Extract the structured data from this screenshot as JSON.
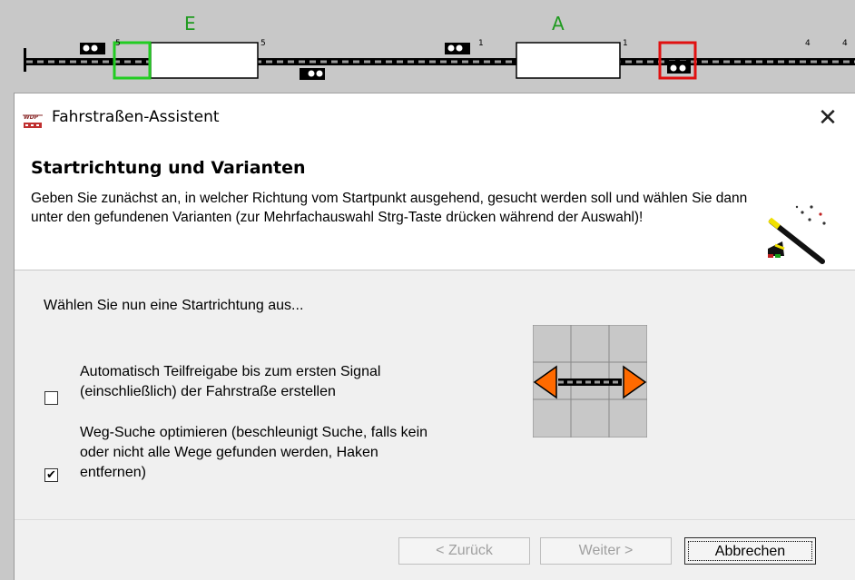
{
  "track": {
    "block_e_label": "E",
    "block_a_label": "A",
    "signal_numbers": [
      "5",
      "5",
      "1",
      "1",
      "4",
      "4"
    ],
    "start_marker_color": "#22cc22",
    "end_marker_color": "#e01010"
  },
  "dialog": {
    "title": "Fahrstraßen-Assistent",
    "close_glyph": "✕",
    "header_title": "Startrichtung und Varianten",
    "header_description": "Geben Sie zunächst an, in welcher Richtung vom Startpunkt ausgehend, gesucht werden soll und wählen Sie dann unter den gefundenen Varianten (zur Mehrfachauswahl Strg-Taste drücken während der Auswahl)!",
    "instruction": "Wählen Sie nun eine Startrichtung aus...",
    "options": [
      {
        "label": "Automatisch Teilfreigabe bis zum ersten Signal (einschließlich) der Fahrstraße erstellen",
        "checked": false,
        "mark": ""
      },
      {
        "label": "Weg-Suche optimieren (beschleunigt Suche, falls kein oder nicht alle Wege gefunden werden, Haken entfernen)",
        "checked": true,
        "mark": "✔"
      }
    ],
    "direction_arrow_color": "#ff6a00",
    "buttons": {
      "back": "< Zurück",
      "next": "Weiter >",
      "cancel": "Abbrechen"
    },
    "app_icon_text": "WDP"
  }
}
